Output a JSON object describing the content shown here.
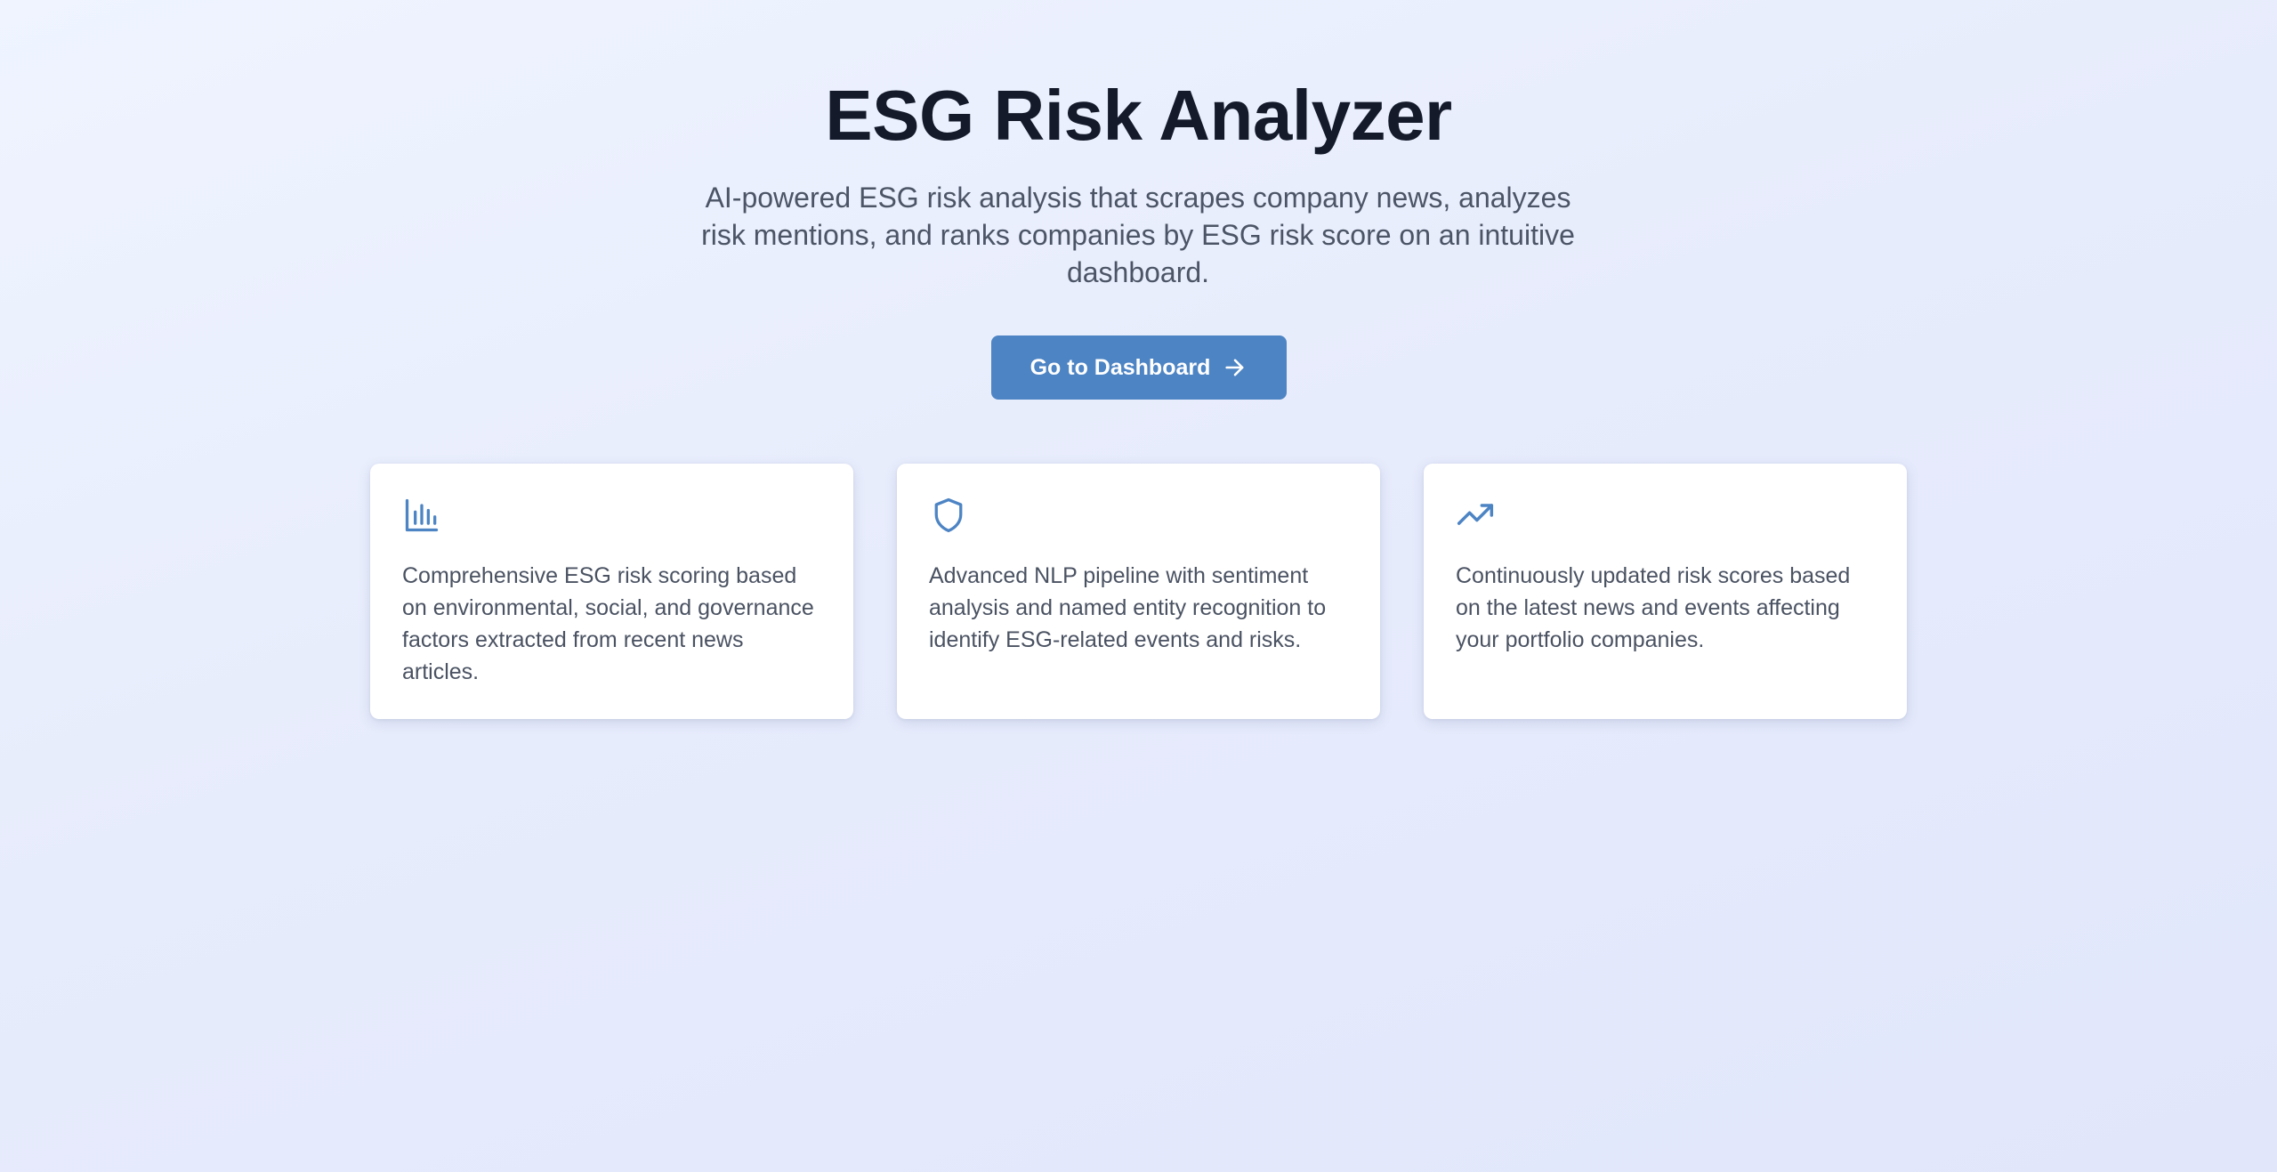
{
  "hero": {
    "title": "ESG Risk Analyzer",
    "subtitle": "AI-powered ESG risk analysis that scrapes company news, analyzes risk mentions, and ranks companies by ESG risk score on an intuitive dashboard.",
    "cta_label": "Go to Dashboard",
    "cta_icon": "arrow-right-icon"
  },
  "features": [
    {
      "icon": "bar-chart-icon",
      "text": "Comprehensive ESG risk scoring based on environmental, social, and governance factors extracted from recent news articles."
    },
    {
      "icon": "shield-icon",
      "text": "Advanced NLP pipeline with sentiment analysis and named entity recognition to identify ESG-related events and risks."
    },
    {
      "icon": "trending-up-icon",
      "text": "Continuously updated risk scores based on the latest news and events affecting your portfolio companies."
    }
  ],
  "colors": {
    "accent": "#4d84c4",
    "title": "#141a2a",
    "body_text": "#4b5565",
    "card_bg": "#ffffff"
  }
}
